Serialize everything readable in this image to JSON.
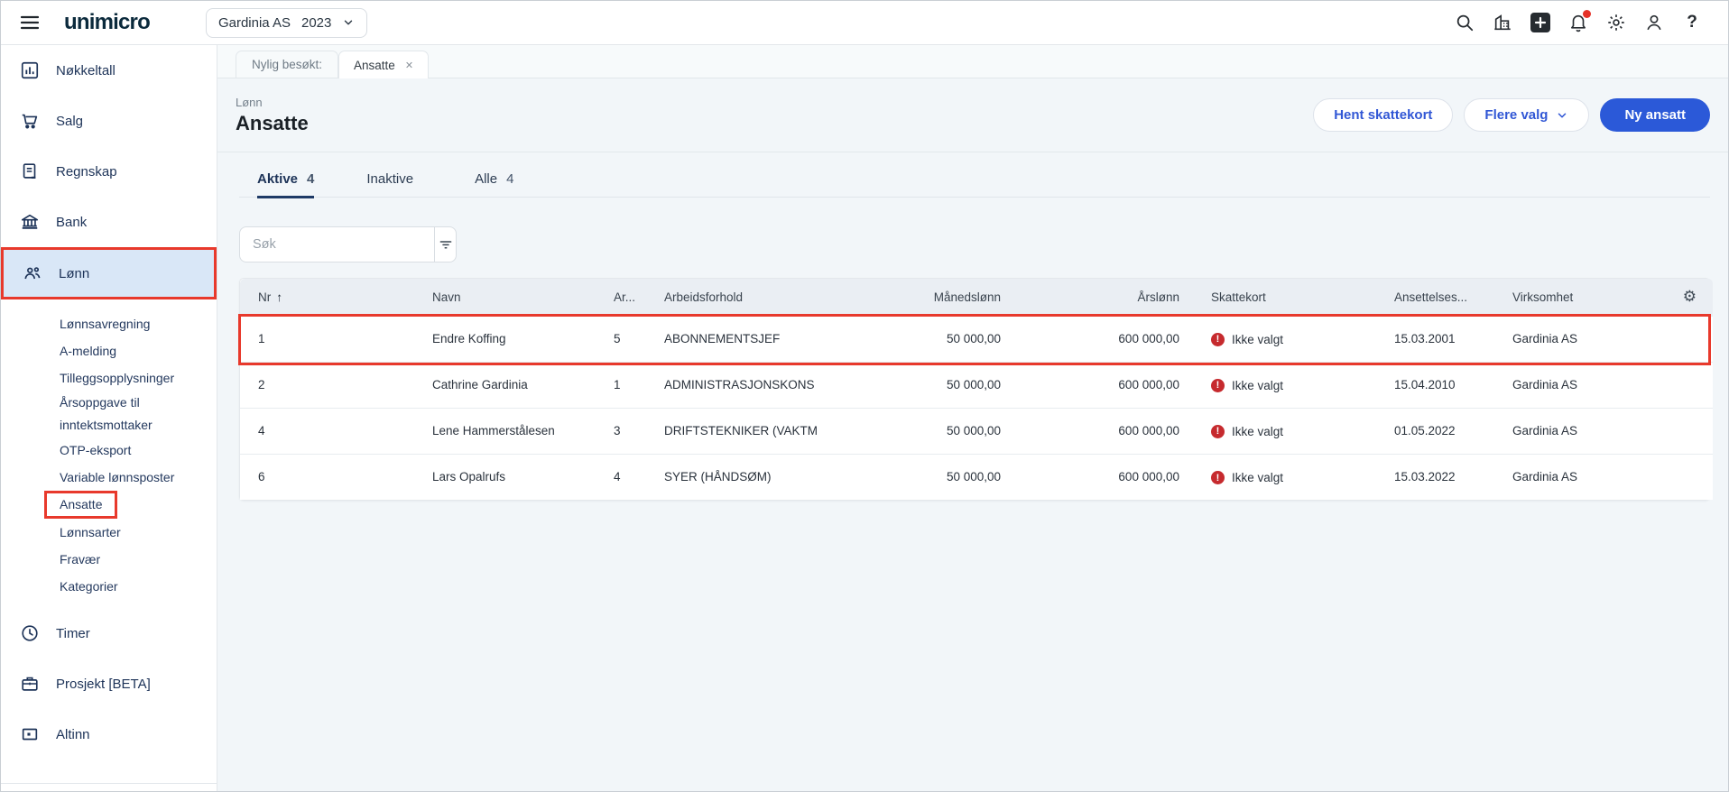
{
  "topbar": {
    "logo": "unimicro",
    "company": {
      "name": "Gardinia AS",
      "year": "2023"
    },
    "help_glyph": "?"
  },
  "sidebar": {
    "items": [
      {
        "label": "Nøkkeltall"
      },
      {
        "label": "Salg"
      },
      {
        "label": "Regnskap"
      },
      {
        "label": "Bank"
      },
      {
        "label": "Lønn"
      },
      {
        "label": "Timer"
      },
      {
        "label": "Prosjekt [BETA]"
      },
      {
        "label": "Altinn"
      }
    ],
    "lonn_submenu": [
      "Lønnsavregning",
      "A-melding",
      "Tilleggsopplysninger",
      "Årsoppgave til inntektsmottaker",
      "OTP-eksport",
      "Variable lønnsposter",
      "Ansatte",
      "Lønnsarter",
      "Fravær",
      "Kategorier"
    ]
  },
  "tabstrip": {
    "recent_label": "Nylig besøkt:",
    "active_tab": "Ansatte",
    "close_glyph": "✕"
  },
  "page_header": {
    "breadcrumb": "Lønn",
    "title": "Ansatte",
    "buttons": {
      "hent_skattekort": "Hent skattekort",
      "flere_valg": "Flere valg",
      "ny_ansatt": "Ny ansatt"
    }
  },
  "tabs": [
    {
      "label": "Aktive",
      "count": "4"
    },
    {
      "label": "Inaktive",
      "count": ""
    },
    {
      "label": "Alle",
      "count": "4"
    }
  ],
  "search": {
    "placeholder": "Søk"
  },
  "table": {
    "columns": {
      "nr": "Nr",
      "navn": "Navn",
      "ar": "Ar...",
      "arbeidsforhold": "Arbeidsforhold",
      "manedslonn": "Månedslønn",
      "arslonn": "Årslønn",
      "skattekort": "Skattekort",
      "ansettelses": "Ansettelses...",
      "virksomhet": "Virksomhet"
    },
    "sort_glyph": "↑",
    "status_glyph": "!",
    "rows": [
      {
        "nr": "1",
        "navn": "Endre Koffing",
        "ar": "5",
        "arbeidsforhold": "ABONNEMENTSJEF",
        "manedslonn": "50 000,00",
        "arslonn": "600 000,00",
        "skattekort": "Ikke valgt",
        "ansettelses": "15.03.2001",
        "virksomhet": "Gardinia AS"
      },
      {
        "nr": "2",
        "navn": "Cathrine Gardinia",
        "ar": "1",
        "arbeidsforhold": "ADMINISTRASJONSKONS",
        "manedslonn": "50 000,00",
        "arslonn": "600 000,00",
        "skattekort": "Ikke valgt",
        "ansettelses": "15.04.2010",
        "virksomhet": "Gardinia AS"
      },
      {
        "nr": "4",
        "navn": "Lene Hammerstålesen",
        "ar": "3",
        "arbeidsforhold": "DRIFTSTEKNIKER (VAKTM",
        "manedslonn": "50 000,00",
        "arslonn": "600 000,00",
        "skattekort": "Ikke valgt",
        "ansettelses": "01.05.2022",
        "virksomhet": "Gardinia AS"
      },
      {
        "nr": "6",
        "navn": "Lars Opalrufs",
        "ar": "4",
        "arbeidsforhold": "SYER (HÅNDSØM)",
        "manedslonn": "50 000,00",
        "arslonn": "600 000,00",
        "skattekort": "Ikke valgt",
        "ansettelses": "15.03.2022",
        "virksomhet": "Gardinia AS"
      }
    ]
  },
  "colors": {
    "accent_blue": "#2b59d8",
    "annotation_red": "#e8392c",
    "status_red": "#c62a2e",
    "sidebar_active_bg": "#d9e7f7",
    "navy": "#1d3358"
  }
}
